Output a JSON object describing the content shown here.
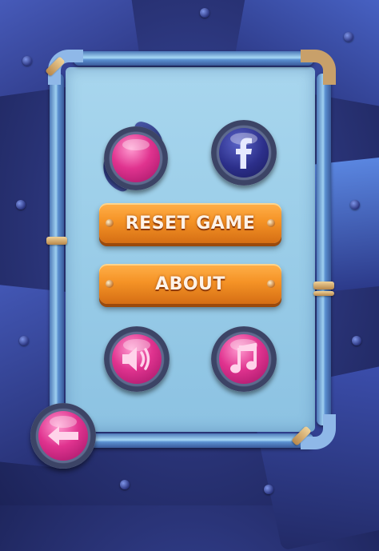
{
  "buttons": {
    "reset_label": "RESET GAME",
    "about_label": "ABOUT"
  },
  "icons": {
    "rocket": "rocket-icon",
    "facebook": "facebook-icon",
    "sound": "speaker-icon",
    "music": "music-note-icon",
    "back": "back-arrow-icon"
  },
  "colors": {
    "accent_pink": "#e0338f",
    "accent_orange": "#f59326",
    "panel_blue": "#9acde8",
    "background_blue": "#2a3478"
  }
}
